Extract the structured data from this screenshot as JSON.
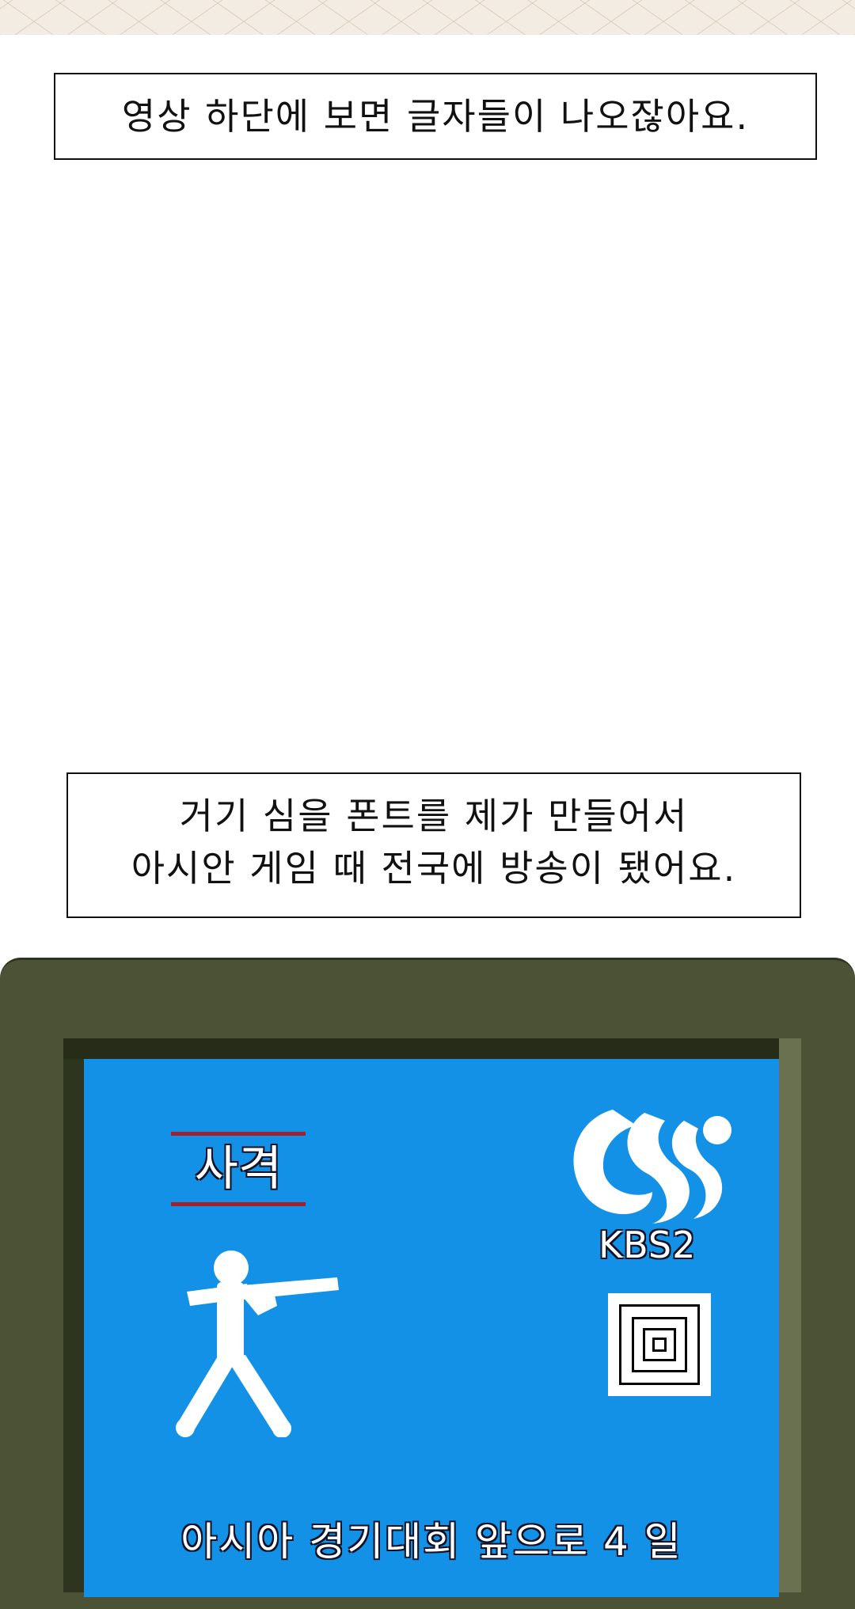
{
  "captions": {
    "first": "영상 하단에 보면 글자들이 나오잖아요.",
    "second_line1": "거기 심을 폰트를 제가 만들어서",
    "second_line2": "아시안 게임 때 전국에 방송이 됐어요."
  },
  "tv": {
    "sport_label": "사격",
    "channel_label": "KBS2",
    "countdown_text": "아시아 경기대회 앞으로 4 일",
    "icons": {
      "sport": "rifle-shooter-icon",
      "broadcaster": "kbs-logo-icon",
      "target": "target-icon"
    },
    "colors": {
      "screen": "#1291e6",
      "tv_frame": "#4b5236",
      "label_underline": "#9e2232"
    }
  }
}
